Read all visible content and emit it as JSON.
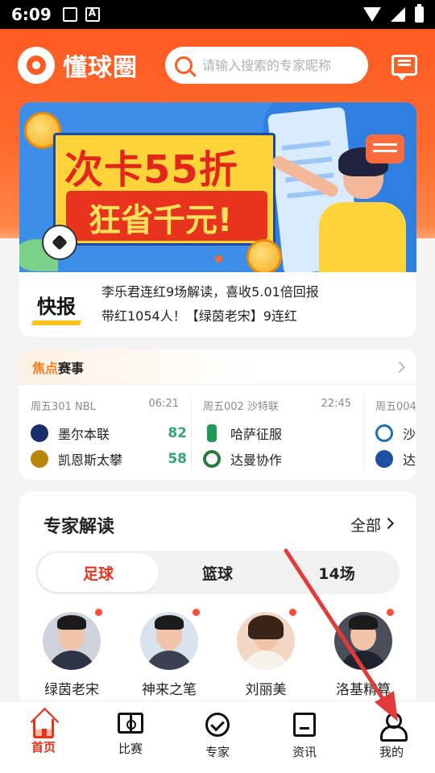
{
  "status_bar": {
    "time": "6:09"
  },
  "header": {
    "app_name": "懂球圈",
    "search_placeholder": "请输入搜索的专家昵称"
  },
  "banner": {
    "headline": "次卡55折",
    "subline": "狂省千元!"
  },
  "news": {
    "tag": "快报",
    "lines": [
      "李乐君连红9场解读，喜收5.01倍回报",
      "带红1054人！【绿茵老宋】9连红"
    ]
  },
  "focus": {
    "title_highlight": "焦点",
    "title_rest": "赛事",
    "matches": [
      {
        "meta": "周五301  NBL",
        "time": "06:21",
        "home": {
          "name": "墨尔本联",
          "score": "82"
        },
        "away": {
          "name": "凯恩斯太攀",
          "score": "58"
        }
      },
      {
        "meta": "周五002  沙特联",
        "time": "22:45",
        "home": {
          "name": "哈萨征服",
          "score": ""
        },
        "away": {
          "name": "达曼协作",
          "score": ""
        }
      },
      {
        "meta": "周五004",
        "time": "",
        "home": {
          "name": "沙",
          "score": ""
        },
        "away": {
          "name": "达",
          "score": ""
        }
      }
    ]
  },
  "expert": {
    "title": "专家解读",
    "all_label": "全部",
    "tabs": [
      "足球",
      "篮球",
      "14场"
    ],
    "people": [
      {
        "name": "绿茵老宋"
      },
      {
        "name": "神来之笔"
      },
      {
        "name": "刘丽美"
      },
      {
        "name": "洛基精算"
      }
    ]
  },
  "tabbar": {
    "items": [
      {
        "label": "首页",
        "icon": "home-icon"
      },
      {
        "label": "比赛",
        "icon": "match-icon"
      },
      {
        "label": "专家",
        "icon": "expert-icon"
      },
      {
        "label": "资讯",
        "icon": "news-icon"
      },
      {
        "label": "我的",
        "icon": "profile-icon"
      }
    ]
  },
  "colors": {
    "brand": "#ff5a22",
    "accent_red": "#e8331f",
    "score_green": "#2fa86a",
    "annotation_arrow": "#e23b3b"
  }
}
